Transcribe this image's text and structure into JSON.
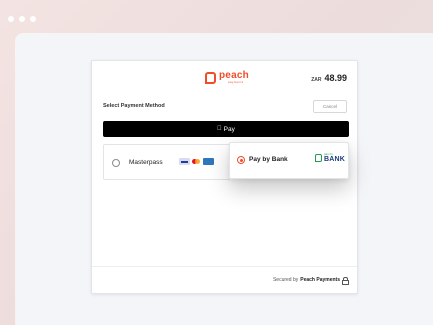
{
  "brand": {
    "logo_name": "peach",
    "logo_sub": "payments",
    "accent_color": "#f04e2a"
  },
  "order": {
    "currency": "ZAR",
    "amount": "48.99"
  },
  "payment": {
    "heading": "Select Payment Method",
    "cancel_label": "Cancel",
    "apple_pay_label": "Pay",
    "apple_icon": "apple-icon",
    "options": [
      {
        "label": "Masterpass",
        "selected": false,
        "cards": [
          "visa",
          "mastercard",
          "amex"
        ]
      },
      {
        "label": "Pay by Bank",
        "selected": true,
        "logo_small": "pay by",
        "logo_bank": "BANK"
      }
    ]
  },
  "footer": {
    "secured_prefix": "Secured by",
    "secured_brand": "Peach Payments"
  }
}
